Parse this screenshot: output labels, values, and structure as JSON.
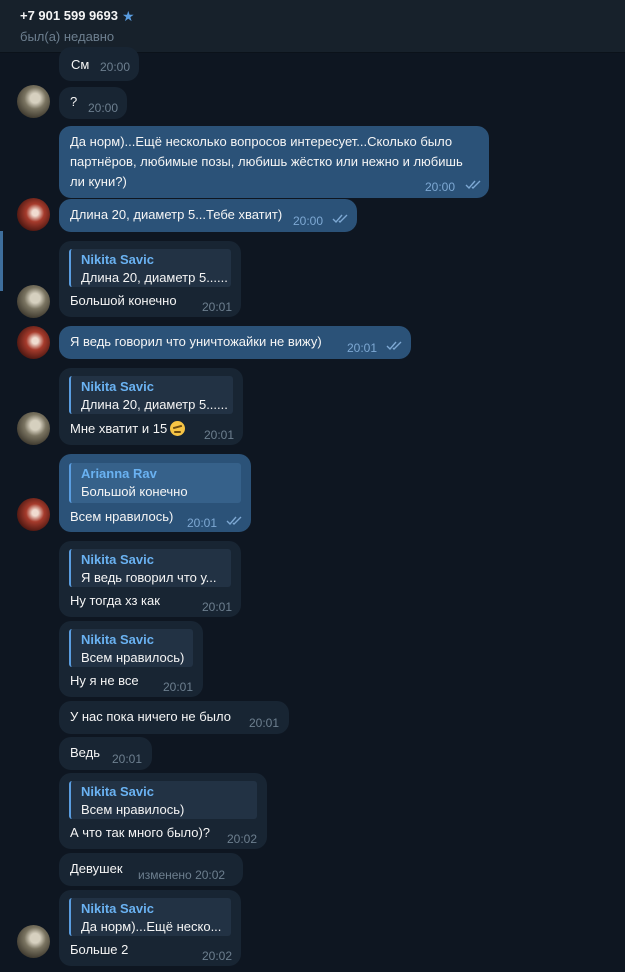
{
  "header": {
    "contact": "+7 901 599 9693",
    "status": "был(а) недавно"
  },
  "messages": [
    {
      "text": "См",
      "time": "20:00"
    },
    {
      "text": "?",
      "time": "20:00"
    },
    {
      "text": "Да норм)...Ещё несколько вопросов интересует...Сколько было партнёров, любимые позы, любишь жёстко или нежно и любишь ли куни?)",
      "time": "20:00"
    },
    {
      "text": "Длина 20, диаметр 5...Тебе хватит)",
      "time": "20:00"
    },
    {
      "reply_name": "Nikita Savic",
      "reply_text": "Длина 20, диаметр 5......",
      "text": "Большой конечно",
      "time": "20:01"
    },
    {
      "text": "Я ведь говорил что уничтожайки не вижу)",
      "time": "20:01"
    },
    {
      "reply_name": "Nikita Savic",
      "reply_text": "Длина 20, диаметр 5......",
      "text": "Мне хватит и 15",
      "emoji": "rolling-eyes-emoji",
      "time": "20:01"
    },
    {
      "reply_name": "Arianna Rav",
      "reply_text": "Большой конечно",
      "text": "Всем нравилось)",
      "time": "20:01"
    },
    {
      "reply_name": "Nikita Savic",
      "reply_text": "Я ведь говорил что у...",
      "text": "Ну тогда хз как",
      "time": "20:01"
    },
    {
      "reply_name": "Nikita Savic",
      "reply_text": "Всем нравилось)",
      "text": "Ну я не все",
      "time": "20:01"
    },
    {
      "text": "У нас пока ничего не было",
      "time": "20:01"
    },
    {
      "text": "Ведь",
      "time": "20:01"
    },
    {
      "reply_name": "Nikita Savic",
      "reply_text": "Всем нравилось)",
      "text": "А что так много было)?",
      "time": "20:02"
    },
    {
      "text": "Девушек",
      "time": "изменено 20:02"
    },
    {
      "reply_name": "Nikita Savic",
      "reply_text": "Да норм)...Ещё неско...",
      "text": "Больше 2",
      "time": "20:02"
    }
  ],
  "colors": {
    "background": "#0e1621",
    "incoming": "#182533",
    "outgoing": "#2b5278",
    "accent": "#6ab2f2"
  },
  "icons": [
    "star-icon",
    "double-check-icon",
    "avatar"
  ]
}
